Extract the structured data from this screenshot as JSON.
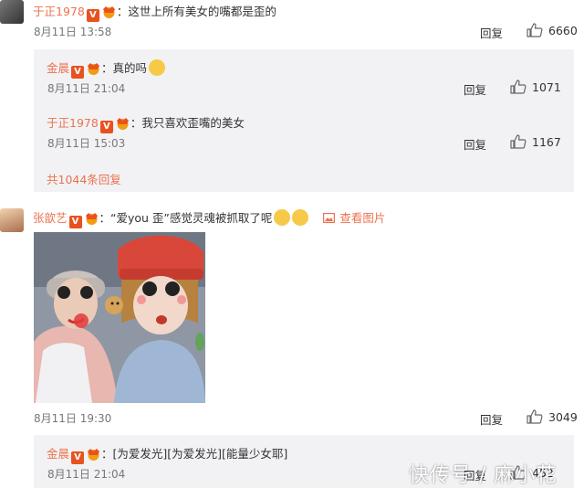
{
  "comments": [
    {
      "user": "于正1978",
      "text": "：这世上所有美女的嘴都是歪的",
      "time": "8月11日 13:58",
      "reply_label": "回复",
      "likes": "6660",
      "replies": [
        {
          "user": "金晨",
          "text": "：真的吗",
          "time": "8月11日 21:04",
          "reply_label": "回复",
          "likes": "1071"
        },
        {
          "user": "于正1978",
          "text": "：我只喜欢歪嘴的美女",
          "time": "8月11日 15:03",
          "reply_label": "回复",
          "likes": "1167"
        }
      ],
      "more_replies": "共1044条回复"
    },
    {
      "user": "张歆艺",
      "text": "：“爱you 歪”感觉灵魂被抓取了呢",
      "view_picture": "查看图片",
      "time": "8月11日 19:30",
      "reply_label": "回复",
      "likes": "3049",
      "replies": [
        {
          "user": "金晨",
          "text": "：[为爱发光][为爱发光][能量少女耶]",
          "time": "8月11日 21:04",
          "reply_label": "回复",
          "likes": "452"
        }
      ]
    }
  ],
  "badge_v": "V",
  "watermark": "快传号 / 麻小花",
  "colors": {
    "name": "#eb7350",
    "badge": "#e8521f",
    "panel": "#f2f2f5"
  },
  "icons": [
    "verified-v-icon",
    "crown-badge-icon",
    "thumbs-up-icon",
    "picture-icon"
  ]
}
